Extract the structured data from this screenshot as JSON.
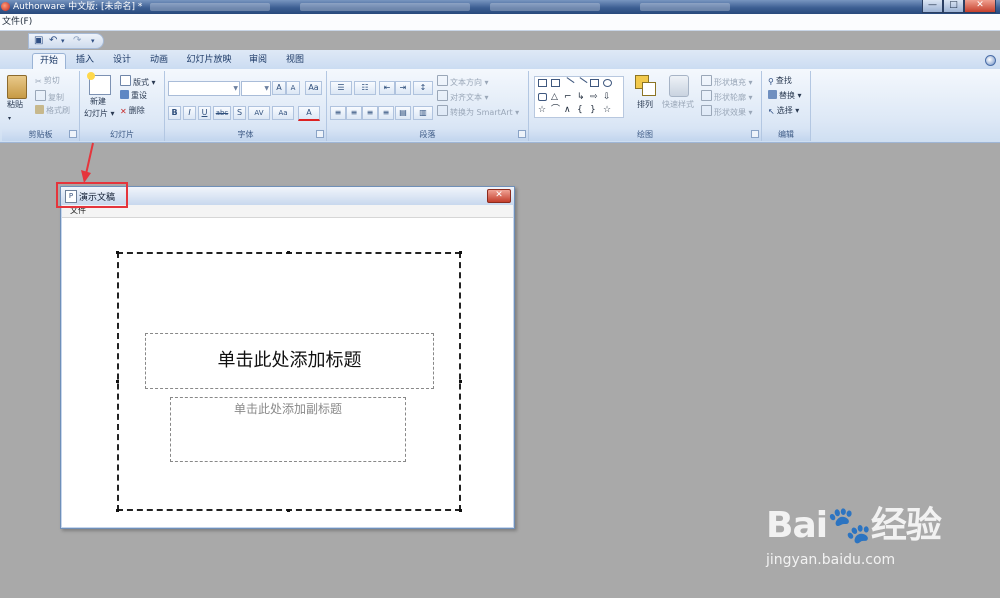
{
  "window": {
    "title": "Authorware 中文版: [未命名] *",
    "minimize": "—",
    "maximize": "□",
    "close": "✕"
  },
  "menubar": {
    "file": "文件(F)"
  },
  "qat": {
    "save": "▣",
    "undo": "↶",
    "redo": "↷",
    "customize": "▾"
  },
  "tabs": [
    "开始",
    "插入",
    "设计",
    "动画",
    "幻灯片放映",
    "审阅",
    "视图"
  ],
  "ribbon": {
    "clipboard": {
      "label": "剪贴板",
      "paste": "粘贴",
      "cut": "剪切",
      "copy": "复制",
      "format_painter": "格式刷"
    },
    "slides": {
      "label": "幻灯片",
      "new_slide": "新建",
      "new_slide_2": "幻灯片",
      "layout": "版式",
      "reset": "重设",
      "delete": "删除"
    },
    "font": {
      "label": "字体",
      "grow": "A",
      "shrink": "A",
      "clear": "Aa",
      "bold": "B",
      "italic": "I",
      "underline": "U",
      "strike": "abc",
      "shadow": "S",
      "spacing": "AV",
      "case": "Aa",
      "color": "A"
    },
    "paragraph": {
      "label": "段落",
      "text_direction": "文本方向",
      "align_text": "对齐文本",
      "smartart": "转换为 SmartArt"
    },
    "drawing": {
      "label": "绘图",
      "arrange": "排列",
      "quick_styles": "快速样式",
      "shape_fill": "形状填充",
      "shape_outline": "形状轮廓",
      "shape_effects": "形状效果"
    },
    "editing": {
      "label": "编辑",
      "find": "查找",
      "replace": "替换",
      "select": "选择"
    }
  },
  "document": {
    "title": "演示文稿",
    "close": "✕",
    "menu_file": "文件",
    "title_placeholder": "单击此处添加标题",
    "subtitle_placeholder": "单击此处添加副标题"
  },
  "watermark": {
    "logo": "Bai🐾经验",
    "url": "jingyan.baidu.com"
  },
  "colors": {
    "highlight": "#e5353c",
    "background": "#a9a9a9",
    "ribbon": "#dde8f6"
  }
}
